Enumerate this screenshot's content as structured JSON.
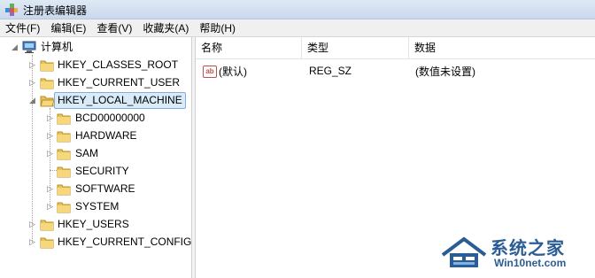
{
  "window": {
    "title": "注册表编辑器"
  },
  "menu": [
    "文件(F)",
    "编辑(E)",
    "查看(V)",
    "收藏夹(A)",
    "帮助(H)"
  ],
  "tree": {
    "root": "计算机",
    "hives": [
      {
        "label": "HKEY_CLASSES_ROOT"
      },
      {
        "label": "HKEY_CURRENT_USER"
      },
      {
        "label": "HKEY_LOCAL_MACHINE",
        "selected": true
      },
      {
        "label": "HKEY_USERS"
      },
      {
        "label": "HKEY_CURRENT_CONFIG"
      }
    ],
    "hklm_children": [
      {
        "label": "BCD00000000",
        "expandable": true
      },
      {
        "label": "HARDWARE",
        "expandable": true
      },
      {
        "label": "SAM",
        "expandable": true
      },
      {
        "label": "SECURITY",
        "expandable": false
      },
      {
        "label": "SOFTWARE",
        "expandable": true
      },
      {
        "label": "SYSTEM",
        "expandable": true
      }
    ]
  },
  "list": {
    "columns": [
      "名称",
      "类型",
      "数据"
    ],
    "rows": [
      {
        "name": "(默认)",
        "type": "REG_SZ",
        "data": "(数值未设置)",
        "icon": "ab"
      }
    ]
  },
  "watermark": {
    "main": "系统之家",
    "sub": "Win10net.com"
  },
  "colors": {
    "selection": "#d9ebf9",
    "selection_border": "#84acdd",
    "folder": "#e8c25a",
    "watermark": "#2a5d95"
  }
}
